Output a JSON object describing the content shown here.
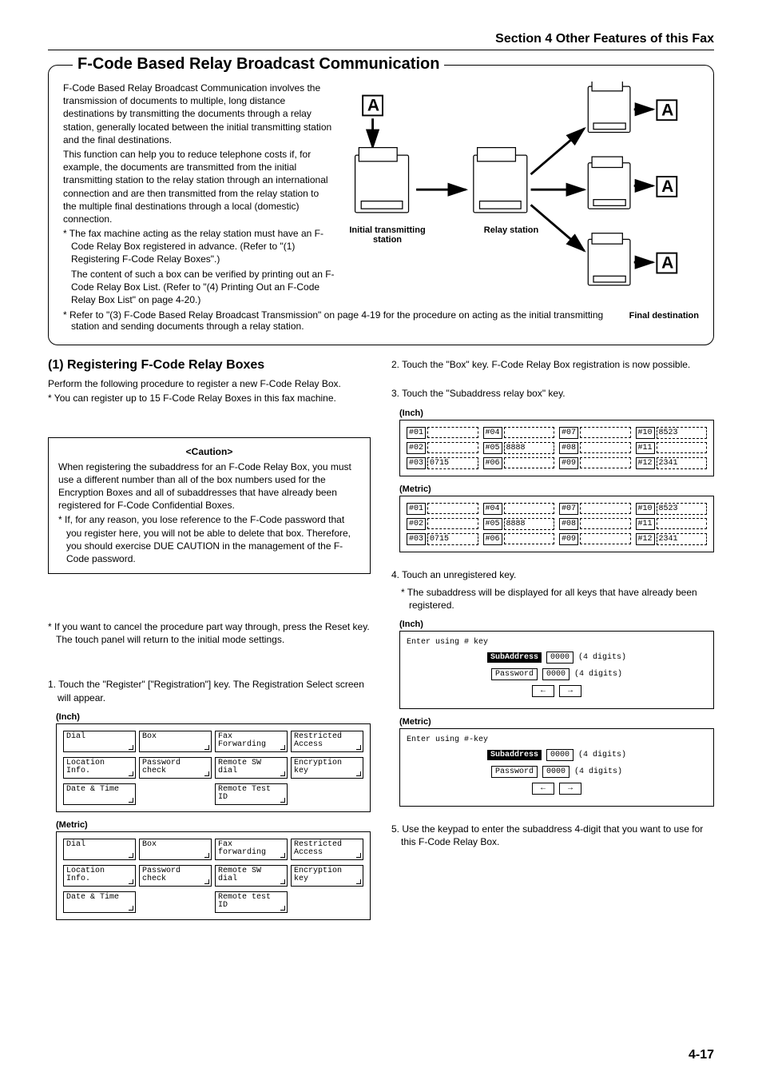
{
  "header": "Section 4 Other Features of this Fax",
  "pageNumber": "4-17",
  "mainTitle": "F-Code Based Relay Broadcast Communication",
  "intro": {
    "p1": "F-Code Based Relay Broadcast Communication involves the transmission of documents to multiple, long distance destinations by transmitting the documents through a relay station, generally located between the initial transmitting station and the final destinations.",
    "p2": "This function can help you to reduce telephone costs if, for example, the documents are transmitted from the initial transmitting station to the relay station through an international connection and are then transmitted from the relay station to the multiple final destinations through a local (domestic) connection.",
    "star1a": "* The fax machine acting as the relay station must have an F-Code Relay Box registered in advance. (Refer to \"(1) Registering F-Code Relay Boxes\".)",
    "star1b": "The content of such a box can be verified by printing out an F-Code Relay Box List. (Refer to \"(4) Printing Out an F-Code Relay Box List\" on page 4-20.)",
    "star2": "* Refer to \"(3) F-Code Based Relay Broadcast Transmission\" on page 4-19 for the procedure on acting as the initial transmitting station and sending documents through a relay station.",
    "diagLabels": {
      "initial": "Initial transmitting station",
      "relay": "Relay station",
      "final": "Final destination"
    }
  },
  "left": {
    "subTitle": "(1) Registering F-Code Relay Boxes",
    "p1": "Perform the following procedure to register a new F-Code Relay Box.",
    "p2": "* You can register up to 15 F-Code Relay Boxes in this fax machine.",
    "cautionTitle": "<Caution>",
    "caution1": "When registering the subaddress for an F-Code Relay Box, you must use a different number than all of the box numbers used for the Encryption Boxes and all of subaddresses that have already been registered for F-Code Confidential Boxes.",
    "caution2": "* If, for any reason, you lose reference to the F-Code password that you register here, you will not be able to delete that box. Therefore, you should exercise DUE CAUTION in the management of the F-Code password.",
    "cancelNote": "* If you want to cancel the procedure part way through, press the Reset key. The touch panel will return to the initial mode settings.",
    "step1": "1. Touch the \"Register\" [\"Registration\"] key. The Registration Select screen will appear.",
    "inchLabel": "(Inch)",
    "metricLabel": "(Metric)",
    "inchButtons": [
      "Dial",
      "Box",
      "Fax Forwarding",
      "Restricted Access",
      "Location Info.",
      "Password check",
      "Remote SW dial",
      "Encryption key",
      "Date & Time",
      "",
      "Remote Test ID",
      ""
    ],
    "metricButtons": [
      "Dial",
      "Box",
      "Fax forwarding",
      "Restricted Access",
      "Location Info.",
      "Password check",
      "Remote SW dial",
      "Encryption key",
      "Date & Time",
      "",
      "Remote test ID",
      ""
    ]
  },
  "right": {
    "step2": "2. Touch the \"Box\" key. F-Code Relay Box registration is now possible.",
    "step3": "3. Touch the \"Subaddress relay box\" key.",
    "inchLabel": "(Inch)",
    "metricLabel": "(Metric)",
    "slotsInch": [
      {
        "n": "#01",
        "v": ""
      },
      {
        "n": "#04",
        "v": ""
      },
      {
        "n": "#07",
        "v": ""
      },
      {
        "n": "#10",
        "v": "8523"
      },
      {
        "n": "#02",
        "v": ""
      },
      {
        "n": "#05",
        "v": "8888"
      },
      {
        "n": "#08",
        "v": ""
      },
      {
        "n": "#11",
        "v": ""
      },
      {
        "n": "#03",
        "v": "0715"
      },
      {
        "n": "#06",
        "v": ""
      },
      {
        "n": "#09",
        "v": ""
      },
      {
        "n": "#12",
        "v": "2341"
      }
    ],
    "slotsMetric": [
      {
        "n": "#01",
        "v": ""
      },
      {
        "n": "#04",
        "v": ""
      },
      {
        "n": "#07",
        "v": ""
      },
      {
        "n": "#10",
        "v": "8523"
      },
      {
        "n": "#02",
        "v": ""
      },
      {
        "n": "#05",
        "v": "8888"
      },
      {
        "n": "#08",
        "v": ""
      },
      {
        "n": "#11",
        "v": ""
      },
      {
        "n": "#03",
        "v": "0715"
      },
      {
        "n": "#06",
        "v": ""
      },
      {
        "n": "#09",
        "v": ""
      },
      {
        "n": "#12",
        "v": "2341"
      }
    ],
    "step4": "4. Touch an unregistered key.",
    "step4Note": "* The subaddress will be displayed for all keys that have already been registered.",
    "entryInch": {
      "header": "Enter using # key",
      "subLabel": "SubAddress",
      "subVal": "0000",
      "passLabel": "Password",
      "passVal": "0000",
      "digits": "(4 digits)"
    },
    "entryMetric": {
      "header": "Enter using #-key",
      "subLabel": "Subaddress",
      "subVal": "0000",
      "passLabel": "Password",
      "passVal": "0000",
      "digits": "(4 digits)"
    },
    "step5": "5. Use the keypad to enter the subaddress 4-digit that you want to use for this F-Code Relay Box."
  }
}
